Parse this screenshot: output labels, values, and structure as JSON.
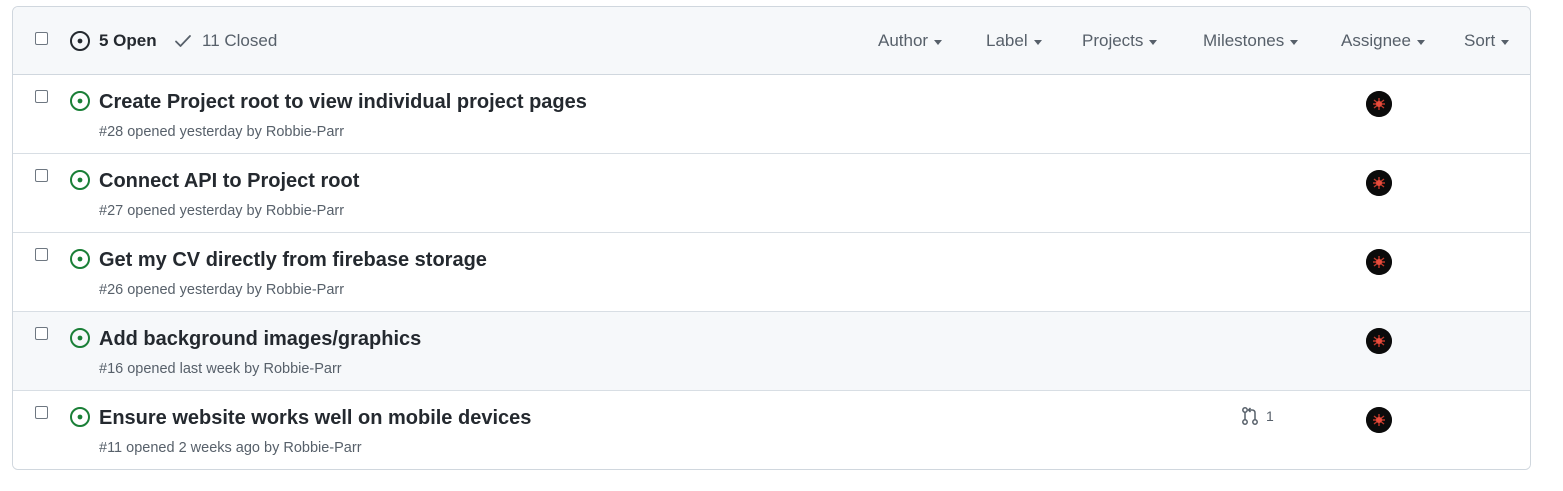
{
  "header": {
    "open_label": "5 Open",
    "closed_label": "11 Closed",
    "filters": [
      {
        "label": "Author"
      },
      {
        "label": "Label"
      },
      {
        "label": "Projects"
      },
      {
        "label": "Milestones"
      },
      {
        "label": "Assignee"
      },
      {
        "label": "Sort"
      }
    ]
  },
  "issues": [
    {
      "title": "Create Project root to view individual project pages",
      "number": "#28",
      "opened": "opened yesterday by",
      "author": "Robbie-Parr",
      "linked_prs": null
    },
    {
      "title": "Connect API to Project root",
      "number": "#27",
      "opened": "opened yesterday by",
      "author": "Robbie-Parr",
      "linked_prs": null
    },
    {
      "title": "Get my CV directly from firebase storage",
      "number": "#26",
      "opened": "opened yesterday by",
      "author": "Robbie-Parr",
      "linked_prs": null
    },
    {
      "title": "Add background images/graphics",
      "number": "#16",
      "opened": "opened last week by",
      "author": "Robbie-Parr",
      "linked_prs": null
    },
    {
      "title": "Ensure website works well on mobile devices",
      "number": "#11",
      "opened": "opened 2 weeks ago by",
      "author": "Robbie-Parr",
      "linked_prs": "1"
    }
  ],
  "colors": {
    "open_green": "#1a7f37",
    "muted": "#57606a",
    "border": "#d0d7de",
    "header_bg": "#f6f8fa",
    "avatar_bg": "#0b0b0b",
    "avatar_accent": "#c0392b"
  },
  "icons": {
    "open_state": "issue-opened-icon",
    "closed_state": "check-icon",
    "linked_pr": "git-pull-request-icon",
    "avatar": "user-avatar"
  }
}
